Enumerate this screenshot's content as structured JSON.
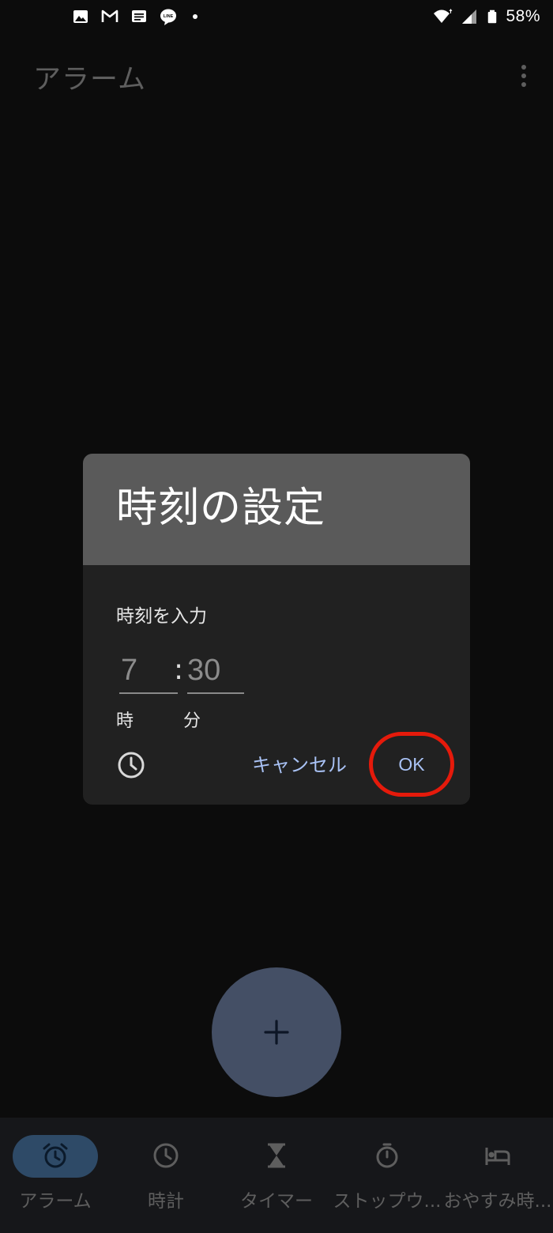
{
  "status_bar": {
    "left_icons": [
      "gallery-icon",
      "gmail-icon",
      "messages-icon",
      "line-icon",
      "notification-dot"
    ],
    "right_icons": [
      "wifi-icon",
      "signal-icon",
      "battery-icon"
    ],
    "battery": "58%"
  },
  "app_bar": {
    "title": "アラーム",
    "menu_icon": "more-vert-icon"
  },
  "dialog": {
    "title": "時刻の設定",
    "input_label": "時刻を入力",
    "hour_value": "7",
    "separator": ":",
    "minute_value": "30",
    "hour_caption": "時",
    "minute_caption": "分",
    "cancel_label": "キャンセル",
    "ok_label": "OK",
    "highlight_color": "#e51a0b"
  },
  "fab": {
    "icon": "plus-icon"
  },
  "bottom_nav": {
    "items": [
      {
        "label": "アラーム",
        "icon": "alarm-icon",
        "active": true
      },
      {
        "label": "時計",
        "icon": "clock-icon",
        "active": false
      },
      {
        "label": "タイマー",
        "icon": "hourglass-icon",
        "active": false
      },
      {
        "label": "ストップウ...",
        "icon": "stopwatch-icon",
        "active": false
      },
      {
        "label": "おやすみ時...",
        "icon": "bed-icon",
        "active": false
      }
    ]
  },
  "colors": {
    "accent": "#a9c2f5",
    "nav_active_pill": "#2e4a67",
    "fab": "#444f65"
  }
}
